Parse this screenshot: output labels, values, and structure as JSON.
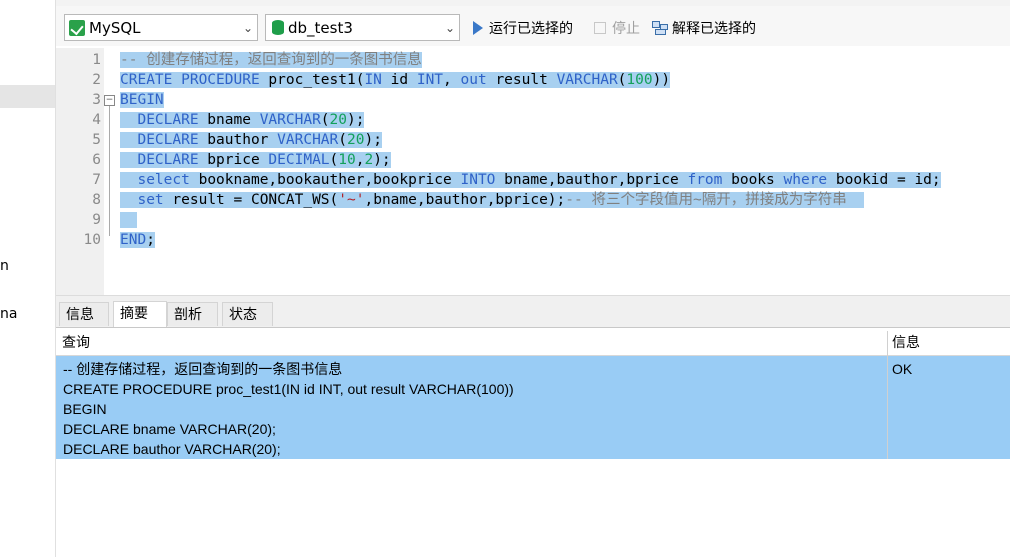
{
  "left_pane": {
    "fragments": [
      "n",
      "na"
    ]
  },
  "toolbar": {
    "connection": "MySQL",
    "database": "db_test3",
    "run_selected": "运行已选择的",
    "stop": "停止",
    "explain_selected": "解释已选择的"
  },
  "editor": {
    "line_numbers": [
      "1",
      "2",
      "3",
      "4",
      "5",
      "6",
      "7",
      "8",
      "9",
      "10"
    ],
    "lines": [
      [
        {
          "t": "-- 创建存储过程，返回查询到的一条图书信息",
          "c": "cm"
        }
      ],
      [
        {
          "t": "CREATE PROCEDURE",
          "c": "kw"
        },
        {
          "t": " proc_test1(",
          "c": ""
        },
        {
          "t": "IN",
          "c": "kw"
        },
        {
          "t": " id ",
          "c": ""
        },
        {
          "t": "INT",
          "c": "kw"
        },
        {
          "t": ", ",
          "c": ""
        },
        {
          "t": "out",
          "c": "kw"
        },
        {
          "t": " result ",
          "c": ""
        },
        {
          "t": "VARCHAR",
          "c": "kw"
        },
        {
          "t": "(",
          "c": ""
        },
        {
          "t": "100",
          "c": "num"
        },
        {
          "t": "))",
          "c": ""
        }
      ],
      [
        {
          "t": "BEGIN",
          "c": "kw"
        }
      ],
      [
        {
          "t": "  ",
          "c": ""
        },
        {
          "t": "DECLARE",
          "c": "kw"
        },
        {
          "t": " bname ",
          "c": ""
        },
        {
          "t": "VARCHAR",
          "c": "kw"
        },
        {
          "t": "(",
          "c": ""
        },
        {
          "t": "20",
          "c": "num"
        },
        {
          "t": ");",
          "c": ""
        }
      ],
      [
        {
          "t": "  ",
          "c": ""
        },
        {
          "t": "DECLARE",
          "c": "kw"
        },
        {
          "t": " bauthor ",
          "c": ""
        },
        {
          "t": "VARCHAR",
          "c": "kw"
        },
        {
          "t": "(",
          "c": ""
        },
        {
          "t": "20",
          "c": "num"
        },
        {
          "t": ");",
          "c": ""
        }
      ],
      [
        {
          "t": "  ",
          "c": ""
        },
        {
          "t": "DECLARE",
          "c": "kw"
        },
        {
          "t": " bprice ",
          "c": ""
        },
        {
          "t": "DECIMAL",
          "c": "kw"
        },
        {
          "t": "(",
          "c": ""
        },
        {
          "t": "10",
          "c": "num"
        },
        {
          "t": ",",
          "c": ""
        },
        {
          "t": "2",
          "c": "num"
        },
        {
          "t": ");",
          "c": ""
        }
      ],
      [
        {
          "t": "  ",
          "c": ""
        },
        {
          "t": "select",
          "c": "kw"
        },
        {
          "t": " bookname,bookauther,bookprice ",
          "c": ""
        },
        {
          "t": "INTO",
          "c": "kw"
        },
        {
          "t": " bname,bauthor,bprice ",
          "c": ""
        },
        {
          "t": "from",
          "c": "kw"
        },
        {
          "t": " books ",
          "c": ""
        },
        {
          "t": "where",
          "c": "kw"
        },
        {
          "t": " bookid = id;",
          "c": ""
        }
      ],
      [
        {
          "t": "  ",
          "c": ""
        },
        {
          "t": "set",
          "c": "kw"
        },
        {
          "t": " result = CONCAT_WS(",
          "c": ""
        },
        {
          "t": "'~'",
          "c": "str"
        },
        {
          "t": ",bname,bauthor,bprice);",
          "c": ""
        },
        {
          "t": "-- 将三个字段值用~隔开，拼接成为字符串",
          "c": "cm"
        }
      ],
      [
        {
          "t": "  ",
          "c": ""
        }
      ],
      [
        {
          "t": "END",
          "c": "kw"
        },
        {
          "t": ";",
          "c": ""
        }
      ]
    ]
  },
  "result_tabs": [
    "信息",
    "摘要",
    "剖析",
    "状态"
  ],
  "result_grid": {
    "headers": [
      "查询",
      "信息"
    ],
    "query_lines": [
      "-- 创建存储过程，返回查询到的一条图书信息",
      "CREATE PROCEDURE proc_test1(IN id INT, out result VARCHAR(100))",
      "BEGIN",
      "DECLARE bname VARCHAR(20);",
      "DECLARE bauthor VARCHAR(20);"
    ],
    "info": "OK"
  },
  "colors": {
    "selection": "#a8d0f0",
    "grid_selection": "#99ccf5",
    "keyword": "#2f62c8",
    "comment": "#808080",
    "number": "#13a05b",
    "string": "#b1242a"
  }
}
